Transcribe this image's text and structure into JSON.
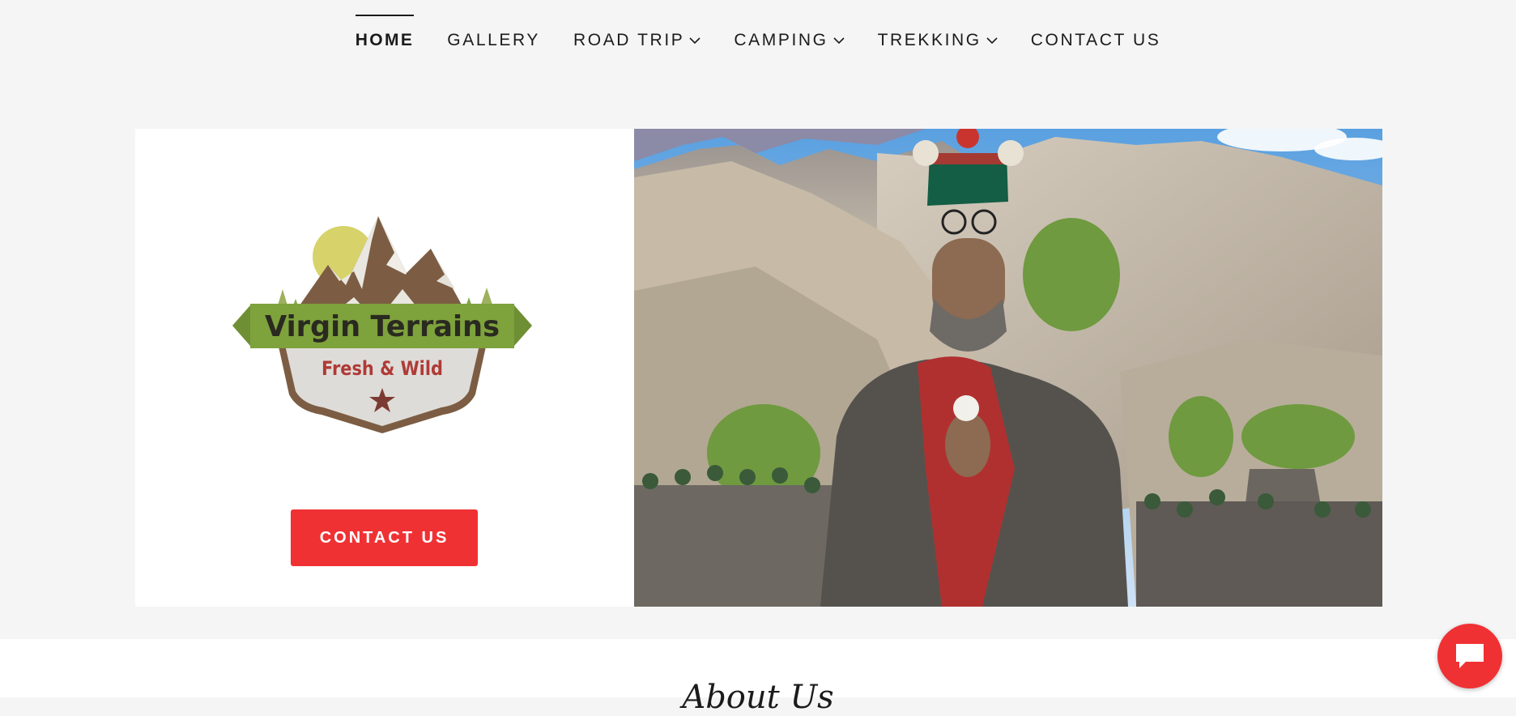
{
  "nav": {
    "items": [
      {
        "label": "HOME",
        "active": true,
        "dropdown": false
      },
      {
        "label": "GALLERY",
        "active": false,
        "dropdown": false
      },
      {
        "label": "ROAD TRIP",
        "active": false,
        "dropdown": true
      },
      {
        "label": "CAMPING",
        "active": false,
        "dropdown": true
      },
      {
        "label": "TREKKING",
        "active": false,
        "dropdown": true
      },
      {
        "label": "CONTACT US",
        "active": false,
        "dropdown": false
      }
    ]
  },
  "hero": {
    "logo": {
      "title": "Virgin Terrains",
      "tagline": "Fresh & Wild"
    },
    "cta_label": "CONTACT US"
  },
  "about": {
    "title": "About Us"
  },
  "colors": {
    "accent": "#f03134",
    "page_bg": "#f5f5f5",
    "logo_green": "#7ea23c",
    "logo_red": "#b03a36",
    "logo_brown": "#7c5d43"
  },
  "icons": {
    "dropdown": "chevron-down-icon",
    "chat": "chat-bubble-icon"
  }
}
